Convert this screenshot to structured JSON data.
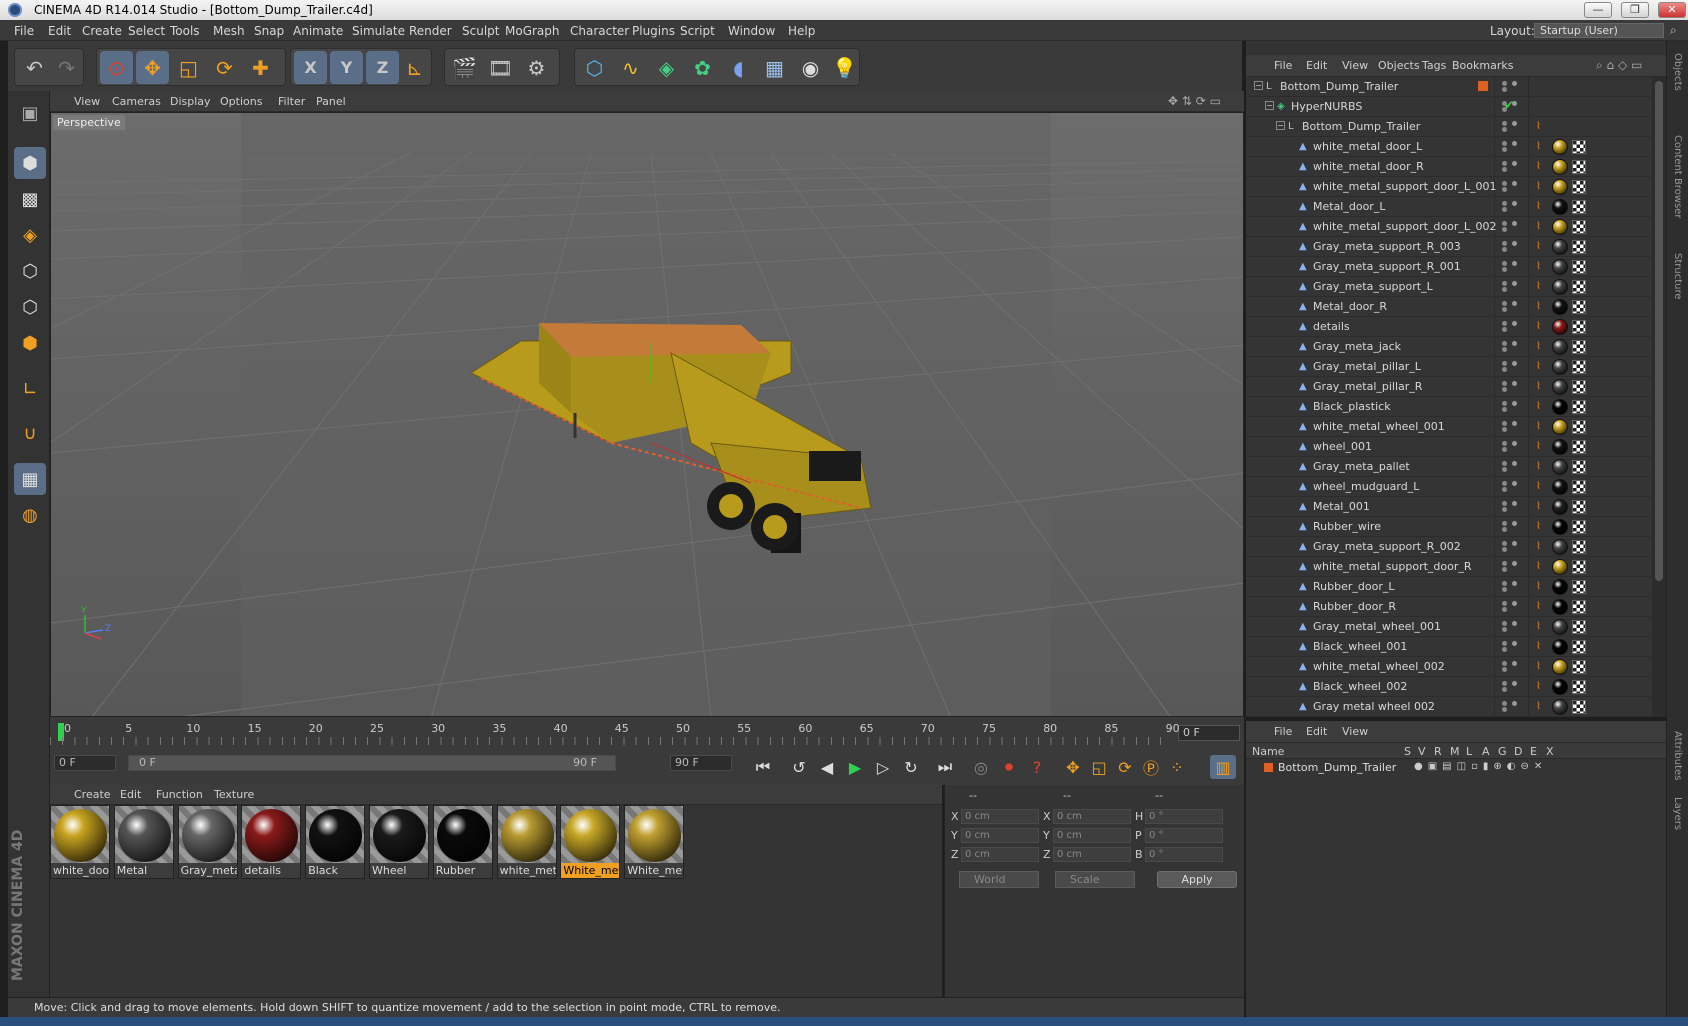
{
  "window": {
    "title": "CINEMA 4D R14.014 Studio - [Bottom_Dump_Trailer.c4d]",
    "min_glyph": "—",
    "max_glyph": "❐",
    "close_glyph": "✕"
  },
  "menubar": {
    "items": [
      "File",
      "Edit",
      "Create",
      "Select",
      "Tools",
      "Mesh",
      "Snap",
      "Animate",
      "Simulate",
      "Render",
      "Sculpt",
      "MoGraph",
      "Character",
      "Plugins",
      "Script",
      "Window",
      "Help"
    ],
    "layout_label": "Layout:",
    "layout_value": "Startup (User)"
  },
  "toolbar": {
    "icons": [
      "undo-icon",
      "redo-icon",
      "live-selection-icon",
      "move-icon",
      "scale-icon",
      "rotate-icon",
      "add-object-icon",
      "lock-x-icon",
      "lock-y-icon",
      "lock-z-icon",
      "coordinate-system-icon",
      "render-view-icon",
      "render-picture-viewer-icon",
      "edit-render-settings-icon",
      "cube-icon",
      "spline-pen-icon",
      "subdivision-surface-icon",
      "cloner-icon",
      "deformer-icon",
      "floor-icon",
      "camera-icon",
      "light-icon"
    ],
    "x_glyph": "X",
    "y_glyph": "Y",
    "z_glyph": "Z"
  },
  "viewport": {
    "menu": [
      "View",
      "Cameras",
      "Display",
      "Options",
      "Filter",
      "Panel"
    ],
    "label": "Perspective",
    "axis_y": "Y",
    "axis_z": "Z"
  },
  "timeline": {
    "ticks": [
      "0",
      "5",
      "10",
      "15",
      "20",
      "25",
      "30",
      "35",
      "40",
      "45",
      "50",
      "55",
      "60",
      "65",
      "70",
      "75",
      "80",
      "85",
      "90"
    ],
    "current_frame": "0 F"
  },
  "transport": {
    "start_field": "0 F",
    "range_start": "0 F",
    "range_end": "90 F",
    "end_field": "90 F"
  },
  "materials": {
    "menu": [
      "Create",
      "Edit",
      "Function",
      "Texture"
    ],
    "items": [
      {
        "label": "white_doo",
        "color": "#c9a420"
      },
      {
        "label": "Metal",
        "color": "#555555"
      },
      {
        "label": "Gray_metal",
        "color": "#666666"
      },
      {
        "label": "details",
        "color": "#8a1a1a"
      },
      {
        "label": "Black",
        "color": "#111111"
      },
      {
        "label": "Wheel",
        "color": "#1a1a1a"
      },
      {
        "label": "Rubber",
        "color": "#0a0a0a"
      },
      {
        "label": "white_meta",
        "color": "#b89a30"
      },
      {
        "label": "White_met",
        "color": "#c8a828",
        "selected": true
      },
      {
        "label": "White_met",
        "color": "#c0a030"
      }
    ]
  },
  "coords": {
    "head1": "--",
    "head2": "--",
    "head3": "--",
    "x": "X",
    "y": "Y",
    "z": "Z",
    "h": "H",
    "p": "P",
    "b": "B",
    "pos_x": "0 cm",
    "pos_y": "0 cm",
    "pos_z": "0 cm",
    "size_x": "0 cm",
    "size_y": "0 cm",
    "size_z": "0 cm",
    "rot_h": "0 °",
    "rot_p": "0 °",
    "rot_b": "0 °",
    "world": "World",
    "scale": "Scale",
    "apply": "Apply"
  },
  "status": {
    "text": "Move: Click and drag to move elements. Hold down SHIFT to quantize movement / add to the selection in point mode, CTRL to remove."
  },
  "object_manager": {
    "menu": [
      "File",
      "Edit",
      "View",
      "Objects",
      "Tags",
      "Bookmarks"
    ],
    "items": [
      {
        "name": "Bottom_Dump_Trailer",
        "depth": 0,
        "kind": "null",
        "mat": null
      },
      {
        "name": "HyperNURBS",
        "depth": 1,
        "kind": "hyper",
        "mat": null
      },
      {
        "name": "Bottom_Dump_Trailer",
        "depth": 2,
        "kind": "null",
        "mat": null
      },
      {
        "name": "white_metal_door_L",
        "depth": 3,
        "kind": "poly",
        "mat": "#c9a420"
      },
      {
        "name": "white_metal_door_R",
        "depth": 3,
        "kind": "poly",
        "mat": "#c9a420"
      },
      {
        "name": "white_metal_support_door_L_001",
        "depth": 3,
        "kind": "poly",
        "mat": "#c9a420"
      },
      {
        "name": "Metal_door_L",
        "depth": 3,
        "kind": "poly",
        "mat": "#111111"
      },
      {
        "name": "white_metal_support_door_L_002",
        "depth": 3,
        "kind": "poly",
        "mat": "#c9a420"
      },
      {
        "name": "Gray_meta_support_R_003",
        "depth": 3,
        "kind": "poly",
        "mat": "#444444"
      },
      {
        "name": "Gray_meta_support_R_001",
        "depth": 3,
        "kind": "poly",
        "mat": "#444444"
      },
      {
        "name": "Gray_meta_support_L",
        "depth": 3,
        "kind": "poly",
        "mat": "#444444"
      },
      {
        "name": "Metal_door_R",
        "depth": 3,
        "kind": "poly",
        "mat": "#111111"
      },
      {
        "name": "details",
        "depth": 3,
        "kind": "poly",
        "mat": "#8a1a1a"
      },
      {
        "name": "Gray_meta_jack",
        "depth": 3,
        "kind": "poly",
        "mat": "#444444"
      },
      {
        "name": "Gray_metal_pillar_L",
        "depth": 3,
        "kind": "poly",
        "mat": "#444444"
      },
      {
        "name": "Gray_metal_pillar_R",
        "depth": 3,
        "kind": "poly",
        "mat": "#444444"
      },
      {
        "name": "Black_plastick",
        "depth": 3,
        "kind": "poly",
        "mat": "#050505"
      },
      {
        "name": "white_metal_wheel_001",
        "depth": 3,
        "kind": "poly",
        "mat": "#c9a420"
      },
      {
        "name": "wheel_001",
        "depth": 3,
        "kind": "poly",
        "mat": "#111111"
      },
      {
        "name": "Gray_meta_pallet",
        "depth": 3,
        "kind": "poly",
        "mat": "#444444"
      },
      {
        "name": "wheel_mudguard_L",
        "depth": 3,
        "kind": "poly",
        "mat": "#111111"
      },
      {
        "name": "Metal_001",
        "depth": 3,
        "kind": "poly",
        "mat": "#222222"
      },
      {
        "name": "Rubber_wire",
        "depth": 3,
        "kind": "poly",
        "mat": "#050505"
      },
      {
        "name": "Gray_meta_support_R_002",
        "depth": 3,
        "kind": "poly",
        "mat": "#444444"
      },
      {
        "name": "white_metal_support_door_R",
        "depth": 3,
        "kind": "poly",
        "mat": "#c9a420"
      },
      {
        "name": "Rubber_door_L",
        "depth": 3,
        "kind": "poly",
        "mat": "#050505"
      },
      {
        "name": "Rubber_door_R",
        "depth": 3,
        "kind": "poly",
        "mat": "#050505"
      },
      {
        "name": "Gray_metal_wheel_001",
        "depth": 3,
        "kind": "poly",
        "mat": "#444444"
      },
      {
        "name": "Black_wheel_001",
        "depth": 3,
        "kind": "poly",
        "mat": "#050505"
      },
      {
        "name": "white_metal_wheel_002",
        "depth": 3,
        "kind": "poly",
        "mat": "#c9a420"
      },
      {
        "name": "Black_wheel_002",
        "depth": 3,
        "kind": "poly",
        "mat": "#050505"
      },
      {
        "name": "Gray metal wheel 002",
        "depth": 3,
        "kind": "poly",
        "mat": "#444444"
      }
    ]
  },
  "layer_manager": {
    "menu": [
      "File",
      "Edit",
      "View"
    ],
    "columns": [
      "Name",
      "S",
      "V",
      "R",
      "M",
      "L",
      "A",
      "G",
      "D",
      "E",
      "X"
    ],
    "layer_name": "Bottom_Dump_Trailer"
  },
  "right_tabs": [
    "Objects",
    "Content Browser",
    "Structure",
    "Attributes",
    "Layers"
  ],
  "maxon_label": "MAXON CINEMA 4D",
  "colors": {
    "accent_select": "#5a6e88",
    "material_highlight": "#f0a020",
    "trailer_yellow": "#b89a1c",
    "viewport_bg": "#5e5e5e"
  }
}
